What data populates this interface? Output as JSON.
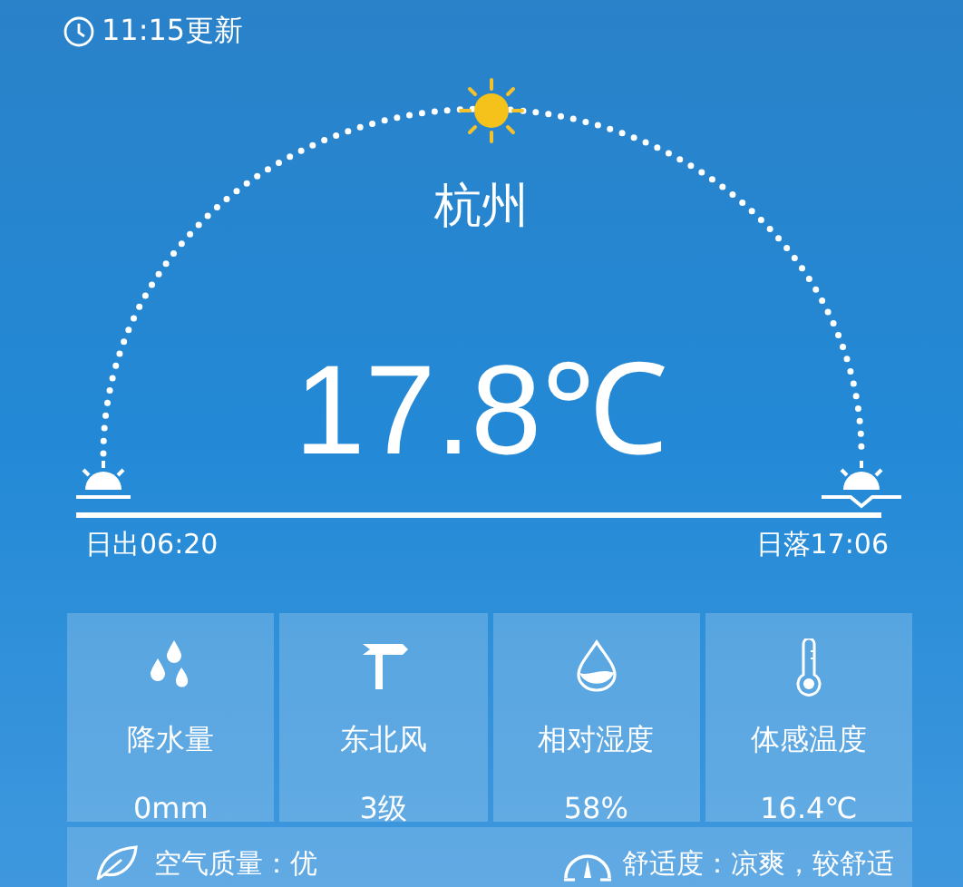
{
  "updated": "11:15更新",
  "city": "杭州",
  "temperature": "17.8℃",
  "sunrise": "日出06:20",
  "sunset": "日落17:06",
  "stats": [
    {
      "kind": "rain",
      "label": "降水量",
      "value": "0mm"
    },
    {
      "kind": "wind",
      "label": "东北风",
      "value": "3级"
    },
    {
      "kind": "humidity",
      "label": "相对湿度",
      "value": "58%"
    },
    {
      "kind": "feel",
      "label": "体感温度",
      "value": "16.4℃"
    }
  ],
  "air_quality": "空气质量：优",
  "comfort": "舒适度：凉爽，较舒适"
}
